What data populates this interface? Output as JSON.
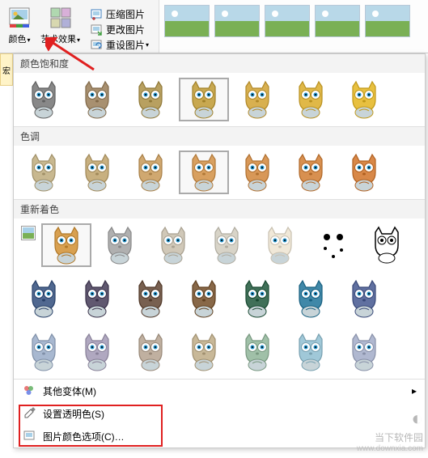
{
  "ribbon": {
    "color_label": "颜色",
    "artistic_label": "艺术效果",
    "compress_label": "压缩图片",
    "change_label": "更改图片",
    "reset_label": "重设图片"
  },
  "panel": {
    "section_saturation": "颜色饱和度",
    "section_tone": "色调",
    "section_recolor": "重新着色",
    "menu_other_variants": "其他变体(M)",
    "menu_set_transparent": "设置透明色(S)",
    "menu_color_options": "图片颜色选项(C)…"
  },
  "left_label": "宏",
  "watermark": {
    "name": "当下软件园",
    "url": "www.downxia.com"
  },
  "saturation_colors": [
    "#888888",
    "#a89070",
    "#b8a060",
    "#c8a850",
    "#d8b050",
    "#e0b848",
    "#e8c040"
  ],
  "tone_colors": [
    "#c8b890",
    "#c8b080",
    "#d0a870",
    "#d8a060",
    "#d89858",
    "#d89050",
    "#d88848"
  ],
  "recolor_rows": [
    [
      "#d8a050",
      "#b0b0b0",
      "#d0c8b8",
      "#d8d4c8",
      "#f0e8d8",
      "#ffffff",
      "#ffffff"
    ],
    [
      "#506890",
      "#605870",
      "#786050",
      "#886848",
      "#407058",
      "#4088a8",
      "#6070a0"
    ],
    [
      "#a8b8d0",
      "#b0a8c0",
      "#c0b0a0",
      "#c8b898",
      "#a0c0a8",
      "#a0c8d8",
      "#b0b8d0"
    ]
  ],
  "recolor_special": {
    "5": "sparse",
    "6": "outline"
  }
}
